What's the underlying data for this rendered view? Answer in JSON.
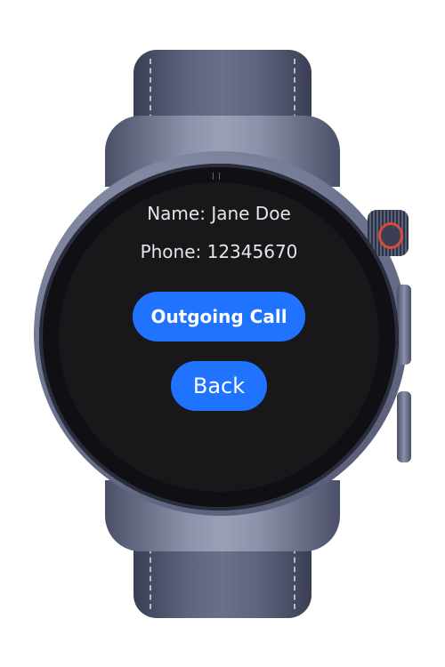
{
  "contact": {
    "name_line": "Name: Jane Doe",
    "phone_line": "Phone: 12345670"
  },
  "actions": {
    "outgoing_call_label": "Outgoing Call",
    "back_label": "Back"
  },
  "colors": {
    "accent": "#1f73ff",
    "screen_background": "#18181b",
    "text": "#e6e6ea",
    "crown_ring": "#d94a38"
  }
}
